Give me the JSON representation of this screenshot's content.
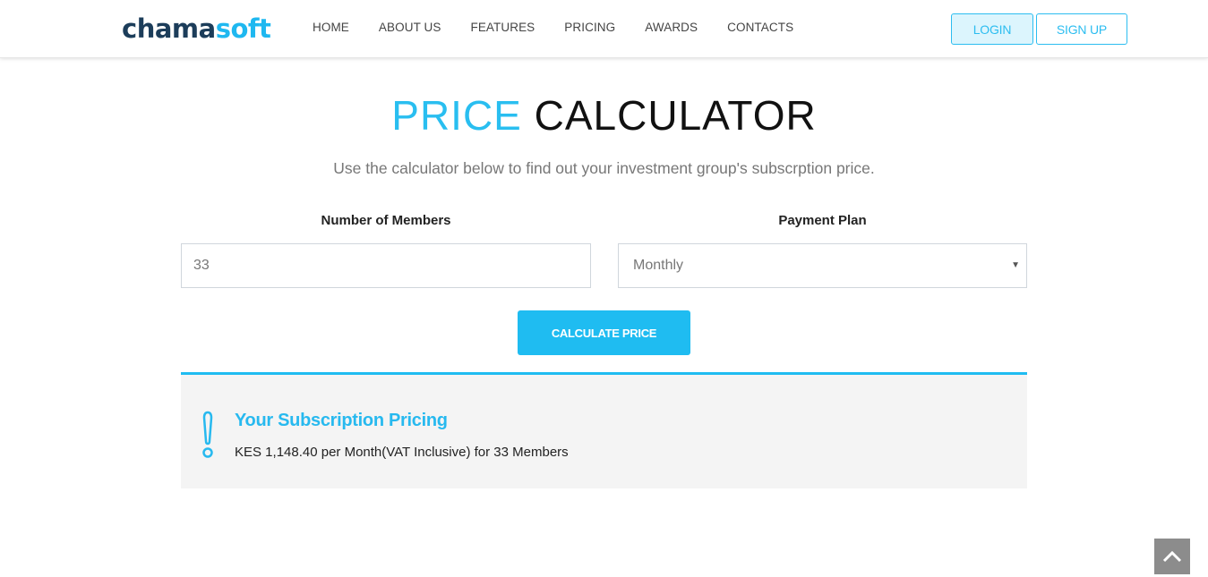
{
  "header": {
    "logo": {
      "part1": "chama",
      "part2": "soft"
    },
    "nav": [
      "HOME",
      "ABOUT US",
      "FEATURES",
      "PRICING",
      "AWARDS",
      "CONTACTS"
    ],
    "login_label": "LOGIN",
    "signup_label": "SIGN UP"
  },
  "main": {
    "title_accent": "PRICE",
    "title_rest": "CALCULATOR",
    "subtitle": "Use the calculator below to find out your investment group's subscrption price.",
    "members_label": "Number of Members",
    "members_value": "33",
    "plan_label": "Payment Plan",
    "plan_selected": "Monthly",
    "calculate_label": "CALCULATE PRICE"
  },
  "result": {
    "icon": "exclamation-icon",
    "title": "Your Subscription Pricing",
    "text": "KES 1,148.40 per Month(VAT Inclusive) for 33 Members"
  },
  "scroll_top": {
    "icon": "chevron-up-icon"
  },
  "colors": {
    "accent": "#1fbcf1",
    "logo_dark": "#1c3d5a",
    "result_bg": "#f4f4f4"
  }
}
